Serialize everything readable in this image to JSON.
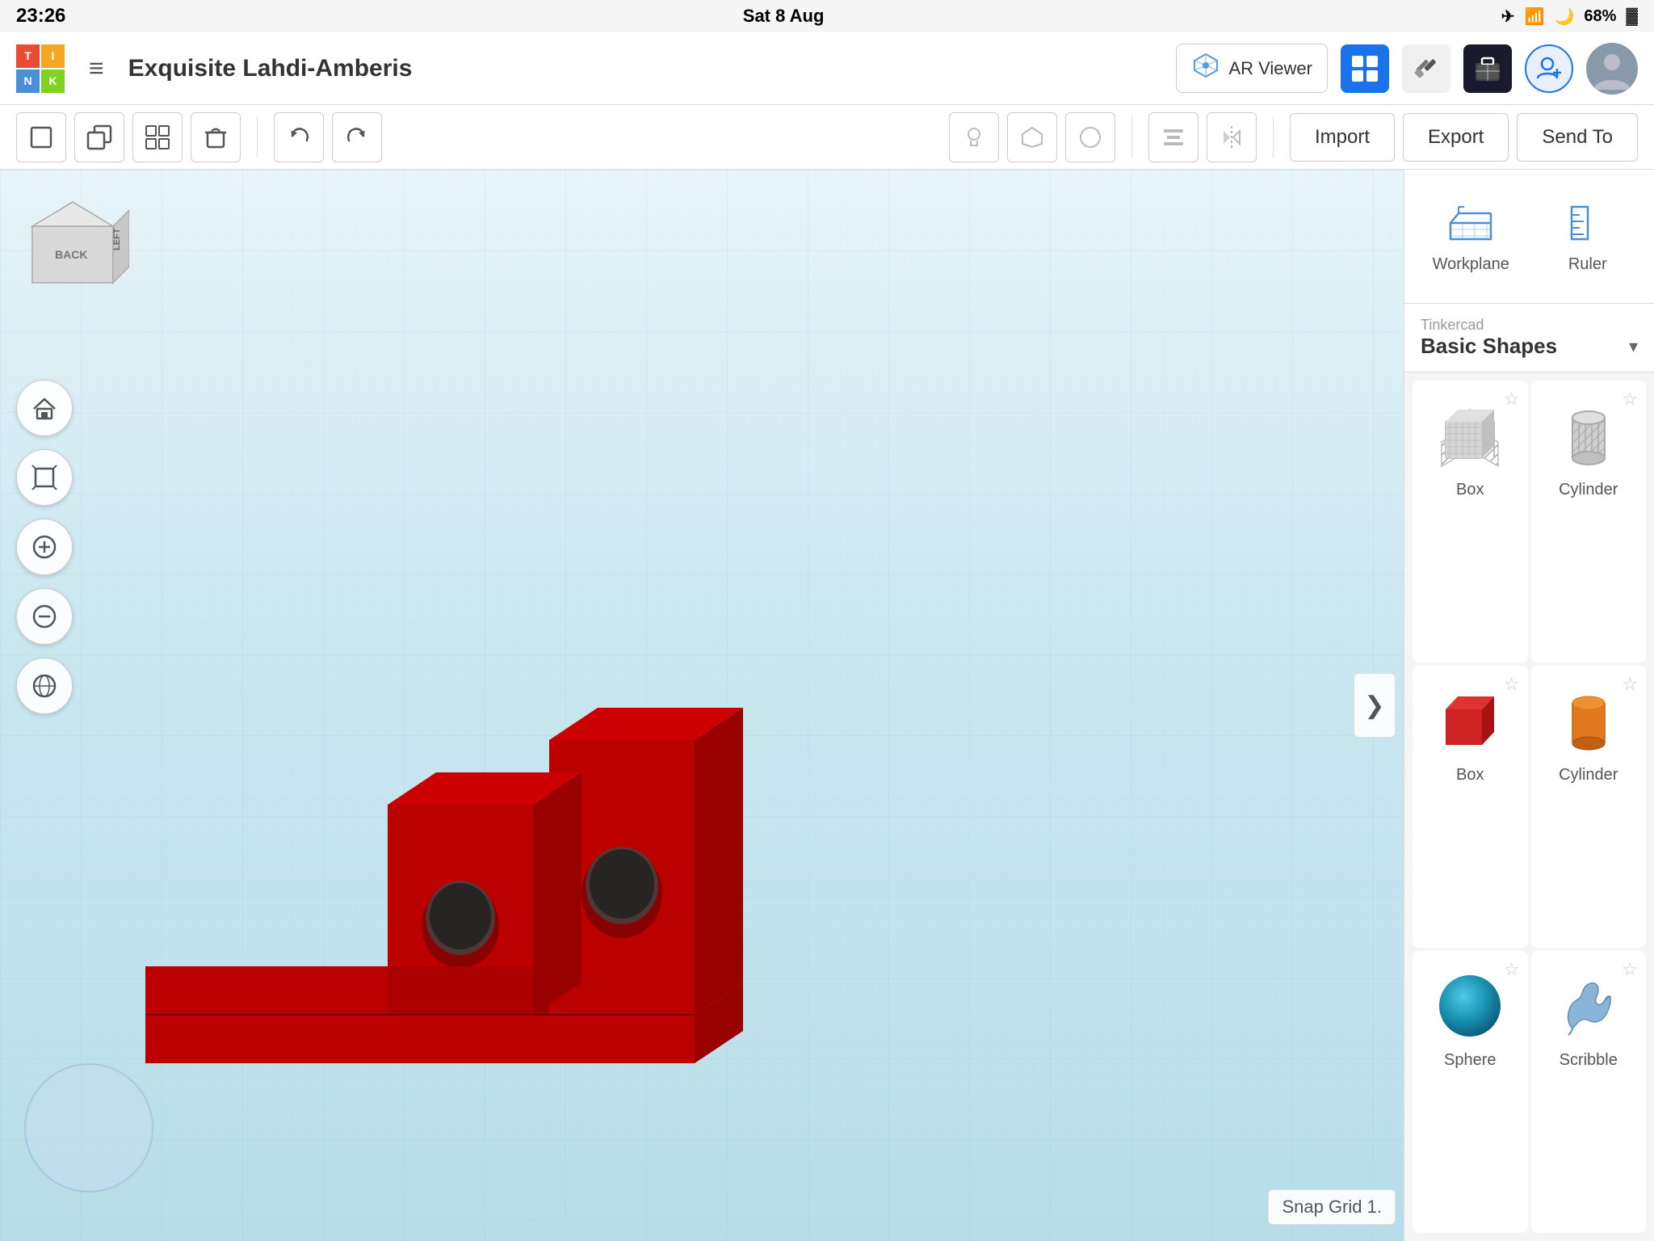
{
  "statusBar": {
    "time": "23:26",
    "date": "Sat 8 Aug",
    "battery": "68%",
    "batteryIcon": "🔋"
  },
  "topNav": {
    "logoLetters": [
      "T",
      "I",
      "N",
      "K"
    ],
    "menuIcon": "≡",
    "projectTitle": "Exquisite Lahdi-Amberis",
    "arViewerLabel": "AR Viewer",
    "importLabel": "Import",
    "exportLabel": "Export",
    "sendToLabel": "Send To"
  },
  "toolbar": {
    "newBtn": "□",
    "copyBtn": "⧉",
    "groupBtn": "⊞",
    "deleteBtn": "🗑",
    "undoBtn": "↩",
    "redoBtn": "↪",
    "lightBtn": "💡",
    "shapeBtn": "⬡",
    "circleBtn": "◯",
    "alignBtn": "⊟",
    "mirrorBtn": "⇅"
  },
  "leftControls": {
    "homeBtn": "⌂",
    "fitBtn": "⊡",
    "zoomInBtn": "+",
    "zoomOutBtn": "−",
    "perspectiveBtn": "⬡"
  },
  "navCube": {
    "backLabel": "BACK",
    "leftLabel": "LEFT"
  },
  "rightPanel": {
    "workplaneLabel": "Workplane",
    "rulerLabel": "Ruler",
    "librarySource": "Tinkercad",
    "libraryName": "Basic Shapes",
    "shapes": [
      {
        "name": "Box",
        "type": "box-gray",
        "starred": false
      },
      {
        "name": "Cylinder",
        "type": "cylinder-gray",
        "starred": false
      },
      {
        "name": "Box",
        "type": "box-red",
        "starred": false
      },
      {
        "name": "Cylinder",
        "type": "cylinder-orange",
        "starred": false
      },
      {
        "name": "Sphere",
        "type": "sphere-blue",
        "starred": false
      },
      {
        "name": "Scribble",
        "type": "scribble-blue",
        "starred": false
      }
    ]
  },
  "viewport": {
    "snapGridLabel": "Snap Grid",
    "snapGridValue": "1.",
    "backLabel": "back"
  }
}
